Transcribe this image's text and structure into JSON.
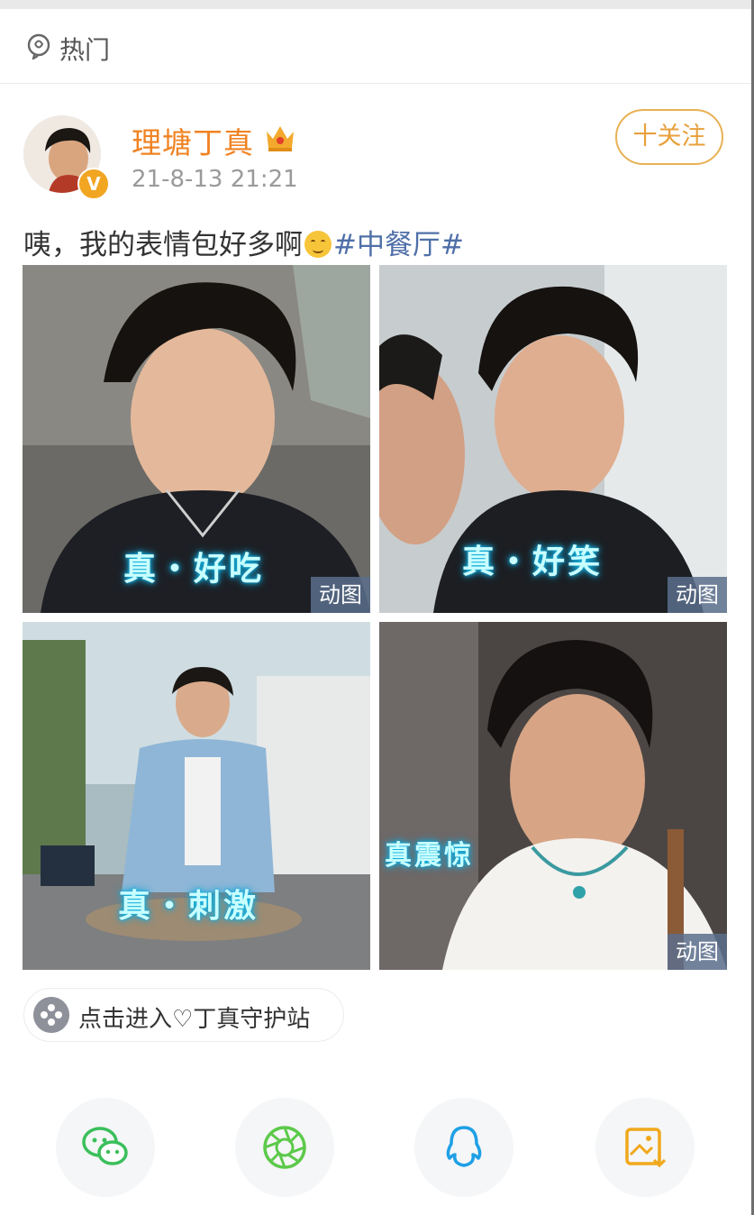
{
  "header": {
    "tab_label": "热门",
    "tab_icon": "hot-topic-icon"
  },
  "post": {
    "username": "理塘丁真",
    "verified": true,
    "member_badge": "crown-icon",
    "timestamp": "21-8-13 21:21",
    "follow_label": "十关注",
    "text_before_emoji": "咦，我的表情包好多啊",
    "emoji": "smile-emoji",
    "hashtag": "#中餐厅#",
    "images": [
      {
        "caption": "真・好吃",
        "gif_label": "动图"
      },
      {
        "caption": "真・好笑",
        "gif_label": "动图"
      },
      {
        "caption": "真・刺激",
        "gif_label": ""
      },
      {
        "caption": "真震惊",
        "gif_label": "动图"
      }
    ],
    "topic_link": "点击进入♡丁真守护站"
  },
  "share_bar": [
    {
      "name": "wechat",
      "icon": "wechat-icon",
      "color": "#3bbf5b"
    },
    {
      "name": "moments",
      "icon": "moments-icon",
      "color": "#5cc94a"
    },
    {
      "name": "qq",
      "icon": "qq-icon",
      "color": "#1ea0e6"
    },
    {
      "name": "save-image",
      "icon": "save-image-icon",
      "color": "#f0a81c"
    }
  ],
  "colors": {
    "username": "#f08323",
    "hashtag": "#4f6fa8",
    "follow": "#e8a03c",
    "caption_glow": "#18b9e4"
  }
}
